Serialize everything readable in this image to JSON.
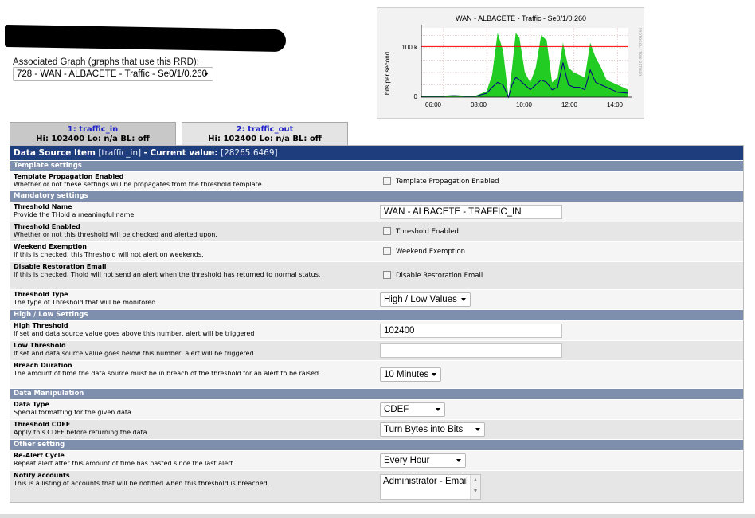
{
  "assoc": {
    "label": "Associated Graph (graphs that use this RRD):",
    "selected": "728 - WAN - ALBACETE - Traffic - Se0/1/0.260"
  },
  "graph": {
    "title": "WAN - ALBACETE - Traffic - Se0/1/0.260",
    "ylabel": "bits per second",
    "side_label": "PROTOCOL / TOBI OETIKER",
    "y_ticks": [
      "100 k",
      "0"
    ],
    "x_ticks": [
      "06:00",
      "08:00",
      "10:00",
      "12:00",
      "14:00"
    ],
    "colors": {
      "in": "#22cc22",
      "out": "#000080",
      "threshold": "#ff0000"
    }
  },
  "chart_data": {
    "type": "area",
    "title": "WAN - ALBACETE - Traffic - Se0/1/0.260",
    "ylabel": "bits per second",
    "x": [
      "05:00",
      "05:30",
      "06:00",
      "06:30",
      "07:00",
      "07:30",
      "08:00",
      "08:15",
      "08:30",
      "08:45",
      "09:00",
      "09:10",
      "09:20",
      "09:30",
      "09:45",
      "10:00",
      "10:15",
      "10:30",
      "10:45",
      "11:00",
      "11:15",
      "11:30",
      "11:45",
      "12:00",
      "12:15",
      "12:30",
      "12:45",
      "13:00",
      "13:15",
      "13:30",
      "13:45",
      "14:00",
      "14:30"
    ],
    "series": [
      {
        "name": "traffic_in",
        "values": [
          3000,
          3000,
          3000,
          4000,
          3000,
          3000,
          12000,
          45000,
          130000,
          95000,
          0,
          60000,
          130000,
          120000,
          50000,
          30000,
          60000,
          125000,
          115000,
          30000,
          40000,
          110000,
          60000,
          50000,
          45000,
          40000,
          110000,
          80000,
          60000,
          35000,
          30000,
          25000,
          15000
        ]
      },
      {
        "name": "traffic_out",
        "values": [
          2000,
          2000,
          2000,
          3000,
          2000,
          2000,
          8000,
          20000,
          30000,
          25000,
          0,
          25000,
          40000,
          35000,
          25000,
          15000,
          25000,
          35000,
          30000,
          15000,
          20000,
          70000,
          25000,
          20000,
          20000,
          15000,
          55000,
          30000,
          25000,
          20000,
          15000,
          10000,
          8000
        ]
      }
    ],
    "threshold": 102400,
    "ylim": [
      0,
      140000
    ],
    "grid": true
  },
  "tabs": [
    {
      "name": "1: traffic_in",
      "info": "Hi: 102400 Lo: n/a BL: off"
    },
    {
      "name": "2: traffic_out",
      "info": "Hi: 102400 Lo: n/a BL: off"
    }
  ],
  "table": {
    "title_prefix": "Data Source Item",
    "title_item": "[traffic_in]",
    "title_current": "- Current value:",
    "title_value": "[28265.6469]",
    "sections": {
      "template": "Template settings",
      "mandatory": "Mandatory settings",
      "highlow": "High / Low Settings",
      "dataman": "Data Manipulation",
      "other": "Other setting"
    },
    "rows": {
      "tpe": {
        "label": "Template Propagation Enabled",
        "desc": "Whether or not these settings will be propagates from the threshold template.",
        "control": "Template Propagation Enabled"
      },
      "name": {
        "label": "Threshold Name",
        "desc": "Provide the THold a meaningful name",
        "value": "WAN - ALBACETE - TRAFFIC_IN"
      },
      "enabled": {
        "label": "Threshold Enabled",
        "desc": "Whether or not this threshold will be checked and alerted upon.",
        "control": "Threshold Enabled"
      },
      "weekend": {
        "label": "Weekend Exemption",
        "desc": "If this is checked, this Threshold will not alert on weekends.",
        "control": "Weekend Exemption"
      },
      "restore": {
        "label": "Disable Restoration Email",
        "desc": "If this is checked, Thold will not send an alert when the threshold has returned to normal status.",
        "control": "Disable Restoration Email"
      },
      "type": {
        "label": "Threshold Type",
        "desc": "The type of Threshold that will be monitored.",
        "value": "High / Low Values"
      },
      "high": {
        "label": "High Threshold",
        "desc": "If set and data source value goes above this number, alert will be triggered",
        "value": "102400"
      },
      "low": {
        "label": "Low Threshold",
        "desc": "If set and data source value goes below this number, alert will be triggered",
        "value": ""
      },
      "breach": {
        "label": "Breach Duration",
        "desc": "The amount of time the data source must be in breach of the threshold for an alert to be raised.",
        "value": "10 Minutes"
      },
      "dtype": {
        "label": "Data Type",
        "desc": "Special formatting for the given data.",
        "value": "CDEF"
      },
      "cdef": {
        "label": "Threshold CDEF",
        "desc": "Apply this CDEF before returning the data.",
        "value": "Turn Bytes into Bits"
      },
      "realert": {
        "label": "Re-Alert Cycle",
        "desc": "Repeat alert after this amount of time has pasted since the last alert.",
        "value": "Every Hour"
      },
      "notify": {
        "label": "Notify accounts",
        "desc": "This is a listing of accounts that will be notified when this threshold is breached.",
        "value": "Administrator - Email"
      }
    }
  }
}
